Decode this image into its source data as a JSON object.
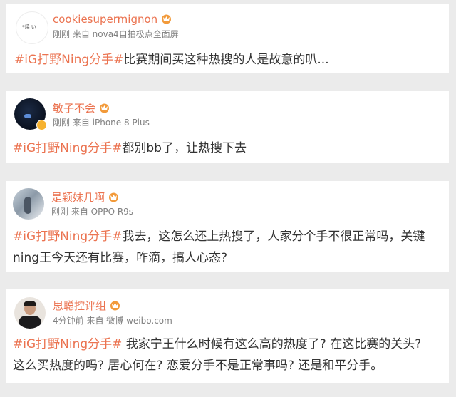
{
  "posts": [
    {
      "username": "cookiesupermignon",
      "avatar_text": "*焼 い",
      "time": "刚刚",
      "source": "来自 nova4自拍极点全面屏",
      "hashtag": "#iG打野Ning分手#",
      "text_lines": [
        "比赛期间买这种热搜的人是故意的叭..."
      ]
    },
    {
      "username": "敏子不会",
      "time": "刚刚",
      "source": "来自 iPhone 8 Plus",
      "hashtag": "#iG打野Ning分手#",
      "text_lines": [
        "都别bb了，让热搜下去"
      ]
    },
    {
      "username": "是颖妹几啊",
      "time": "刚刚",
      "source": "来自 OPPO R9s",
      "hashtag": "#iG打野Ning分手#",
      "text_lines": [
        "我去，这怎么还上热搜了，人家分个手不很正常吗，关键",
        "ning王今天还有比赛，咋滴，搞人心态?"
      ]
    },
    {
      "username": "思聪控评组",
      "time": "4分钟前",
      "source": "来自 微博 weibo.com",
      "hashtag": "#iG打野Ning分手#",
      "text_lines": [
        " 我家宁王什么时候有这么高的热度了? 在这比赛的关头?",
        "这么买热度的吗? 居心何在? 恋爱分手不是正常事吗? 还是和平分手。"
      ]
    }
  ],
  "icons": {
    "badge": "vip-crown-icon",
    "verified": "verified-icon"
  },
  "colors": {
    "accent": "#eb7350",
    "text": "#333333",
    "meta": "#808080",
    "verified": "#f6b230"
  }
}
